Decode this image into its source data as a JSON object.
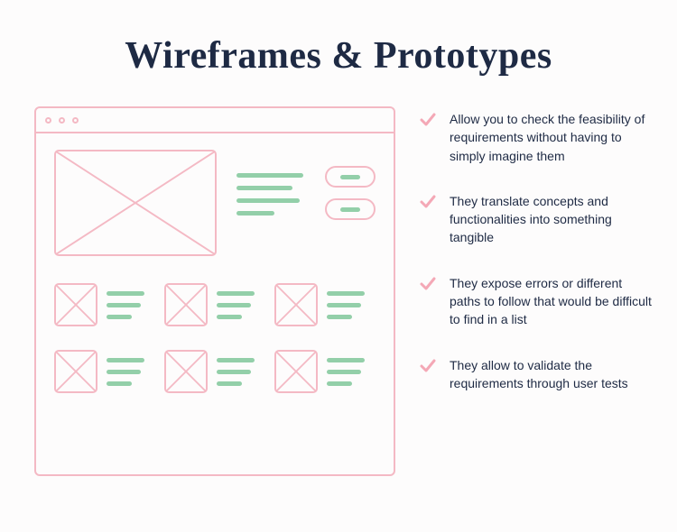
{
  "title": "Wireframes & Prototypes",
  "bullets": [
    {
      "text": "Allow you to check the feasibility of requirements without having to simply imagine them"
    },
    {
      "text": "They translate concepts and functionalities into something tangible"
    },
    {
      "text": "They expose errors or different paths to follow that would be difficult to find in a list"
    },
    {
      "text": "They allow to validate the requirements through user tests"
    }
  ],
  "colors": {
    "heading": "#1e2a44",
    "wireframe_stroke": "#f4b9c4",
    "text_line": "#93cfa9",
    "check": "#f4a8b6"
  }
}
